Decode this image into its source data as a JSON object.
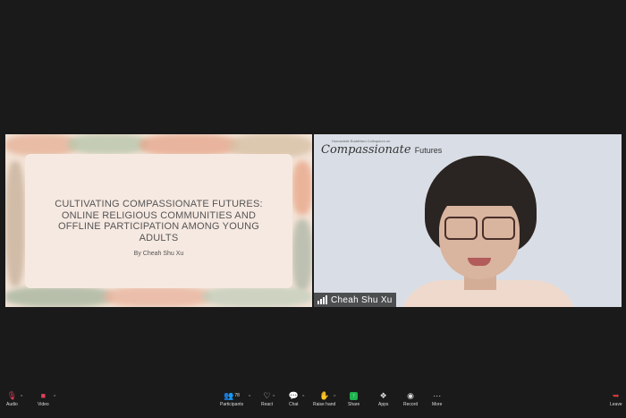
{
  "slide": {
    "title": "CULTIVATING COMPASSIONATE FUTURES: ONLINE RELIGIOUS COMMUNITIES AND OFFLINE PARTICIPATION AMONG YOUNG ADULTS",
    "author": "By Cheah Shu Xu"
  },
  "video": {
    "logo_small": "Humanistic Buddhism Colloquium on",
    "logo_script": "Compassionate",
    "logo_word": "Futures",
    "participant_name": "Cheah Shu Xu"
  },
  "toolbar": {
    "audio": "Audio",
    "video": "Video",
    "participants": "Participants",
    "participants_count": "78",
    "react": "React",
    "chat": "Chat",
    "raise_hand": "Raise hand",
    "share": "Share",
    "apps": "Apps",
    "record": "Record",
    "more": "More",
    "leave": "Leave"
  },
  "colors": {
    "share_green": "#1fb14e",
    "muted_red": "#e0405a",
    "leave_red": "#d93c3c"
  }
}
